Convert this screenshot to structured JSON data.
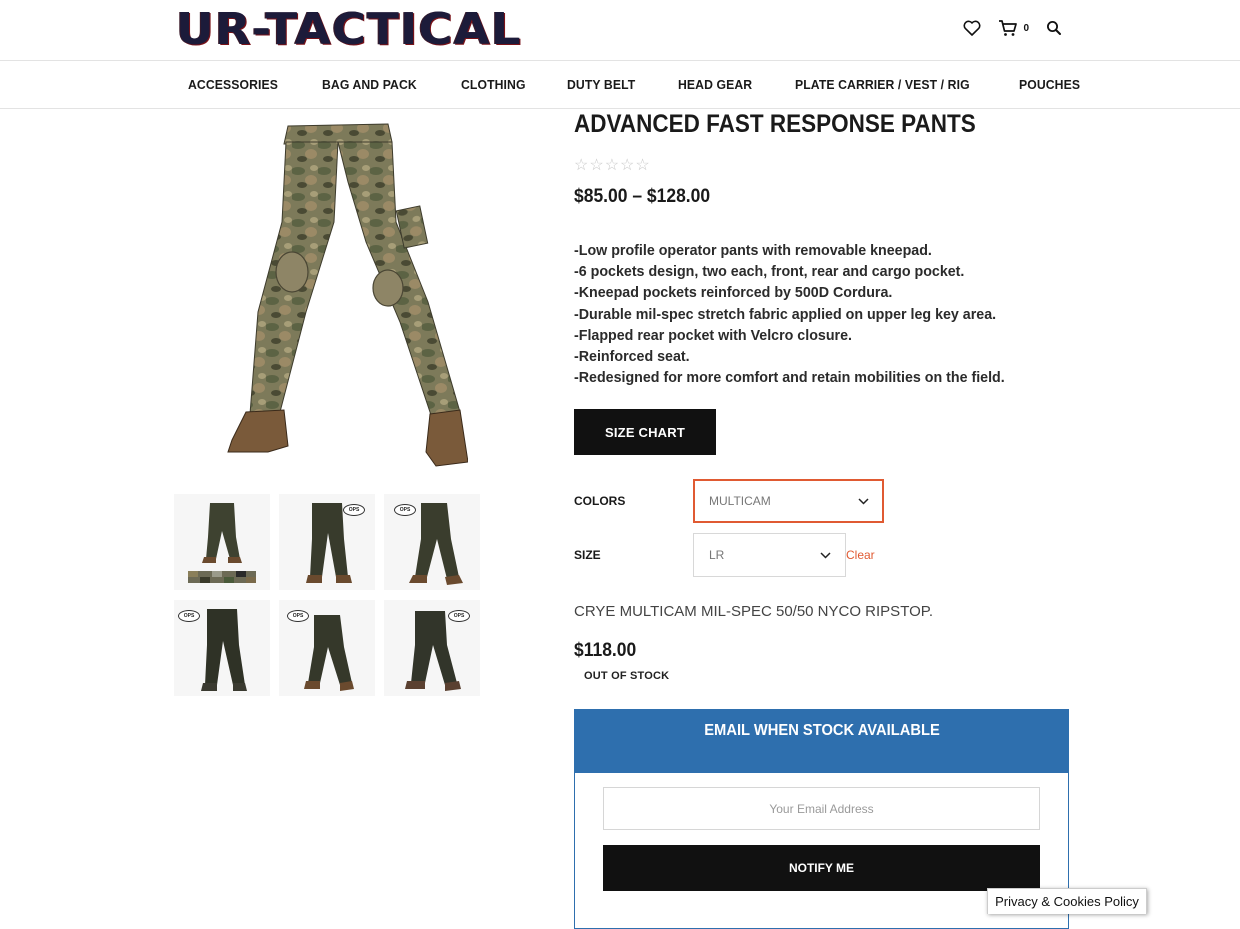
{
  "header": {
    "logo_text": "UR-TACTICAL",
    "icons": [
      "heart-icon",
      "cart-icon",
      "search-icon"
    ],
    "cart_count": "0"
  },
  "nav": {
    "items": [
      "ACCESSORIES",
      "BAG AND PACK",
      "CLOTHING",
      "DUTY BELT",
      "HEAD GEAR",
      "PLATE CARRIER / VEST / RIG",
      "POUCHES"
    ]
  },
  "gallery": {
    "thumbnails": 6,
    "thumb_brand": "OPS"
  },
  "product": {
    "title": "ADVANCED FAST RESPONSE PANTS",
    "rating_stars": "☆☆☆☆☆",
    "rating_value": 0,
    "price_range": "$85.00 – $128.00",
    "description": [
      "-Low profile operator pants with removable kneepad.",
      "-6 pockets design, two each, front, rear and cargo pocket.",
      "-Kneepad pockets reinforced by 500D Cordura.",
      "-Durable mil-spec stretch fabric applied on upper leg key area.",
      "-Flapped rear pocket with Velcro closure.",
      "-Reinforced seat.",
      "-Redesigned for more comfort and retain mobilities on the field."
    ],
    "size_chart_label": "SIZE CHART"
  },
  "variations": {
    "colors_label": "COLORS",
    "colors_value": "MULTICAM",
    "size_label": "SIZE",
    "size_value": "LR",
    "clear_label": "Clear",
    "variation_description": "CRYE MULTICAM MIL-SPEC 50/50 NYCO RIPSTOP.",
    "variation_price": "$118.00",
    "stock_status": "OUT OF STOCK"
  },
  "notify": {
    "heading": "EMAIL WHEN STOCK AVAILABLE",
    "email_placeholder": "Your Email Address",
    "button_label": "NOTIFY ME"
  },
  "cookie": {
    "label": "Privacy & Cookies Policy"
  },
  "colors": {
    "accent_orange": "#e05a32",
    "notify_blue": "#2e6fae",
    "button_black": "#111111"
  }
}
